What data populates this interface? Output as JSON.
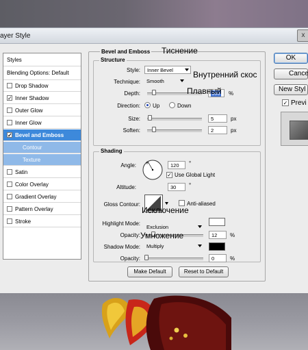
{
  "window": {
    "title": "ayer Style",
    "close_label": "x"
  },
  "left_panel": {
    "header": "Styles",
    "blending": "Blending Options: Default",
    "items": [
      {
        "label": "Drop Shadow",
        "checked": false
      },
      {
        "label": "Inner Shadow",
        "checked": true
      },
      {
        "label": "Outer Glow",
        "checked": false
      },
      {
        "label": "Inner Glow",
        "checked": false
      },
      {
        "label": "Bevel and Emboss",
        "checked": true,
        "selected": true
      },
      {
        "label": "Contour",
        "sub": true
      },
      {
        "label": "Texture",
        "sub": true
      },
      {
        "label": "Satin",
        "checked": false
      },
      {
        "label": "Color Overlay",
        "checked": false
      },
      {
        "label": "Gradient Overlay",
        "checked": false
      },
      {
        "label": "Pattern Overlay",
        "checked": false
      },
      {
        "label": "Stroke",
        "checked": false
      }
    ],
    "check_mark": "✓"
  },
  "bevel": {
    "title": "Bevel and Emboss",
    "structure": {
      "legend": "Structure",
      "style_label": "Style:",
      "style_value": "Inner Bevel",
      "technique_label": "Technique:",
      "technique_value": "Smooth",
      "depth_label": "Depth:",
      "depth_value": "100",
      "depth_unit": "%",
      "depth_level": 0.1,
      "direction_label": "Direction:",
      "dir_up": "Up",
      "dir_down": "Down",
      "direction_selected": "Up",
      "size_label": "Size:",
      "size_value": "5",
      "size_unit": "px",
      "size_level": 0.02,
      "soften_label": "Soften:",
      "soften_value": "2",
      "soften_unit": "px",
      "soften_level": 0.1
    },
    "shading": {
      "legend": "Shading",
      "angle_label": "Angle:",
      "angle_value": "120",
      "angle_unit": "°",
      "global_light_label": "Use Global Light",
      "global_light_checked": true,
      "altitude_label": "Altitude:",
      "altitude_value": "30",
      "altitude_unit": "°",
      "gloss_label": "Gloss Contour:",
      "antialiased_label": "Anti-aliased",
      "antialiased_checked": false,
      "highlight_label": "Highlight Mode:",
      "highlight_value": "Exclusion",
      "highlight_color": "#ffffff",
      "hl_opacity_label": "Opacity:",
      "hl_opacity_value": "12",
      "hl_opacity_unit": "%",
      "hl_opacity_level": 0.12,
      "shadow_label": "Shadow Mode:",
      "shadow_value": "Multiply",
      "shadow_color": "#000000",
      "sh_opacity_label": "Opacity:",
      "sh_opacity_value": "0",
      "sh_opacity_unit": "%",
      "sh_opacity_level": 0
    },
    "make_default": "Make Default",
    "reset_default": "Reset to Default"
  },
  "right_buttons": {
    "ok": "OK",
    "cancel": "Cance",
    "new_style": "New Styl",
    "preview": "Previ"
  },
  "annotations": {
    "emboss": "Тиснение",
    "inner_bevel": "Внутренний скос",
    "smooth": "Плавный",
    "exclusion": "Исключение",
    "multiply": "Умножение"
  }
}
